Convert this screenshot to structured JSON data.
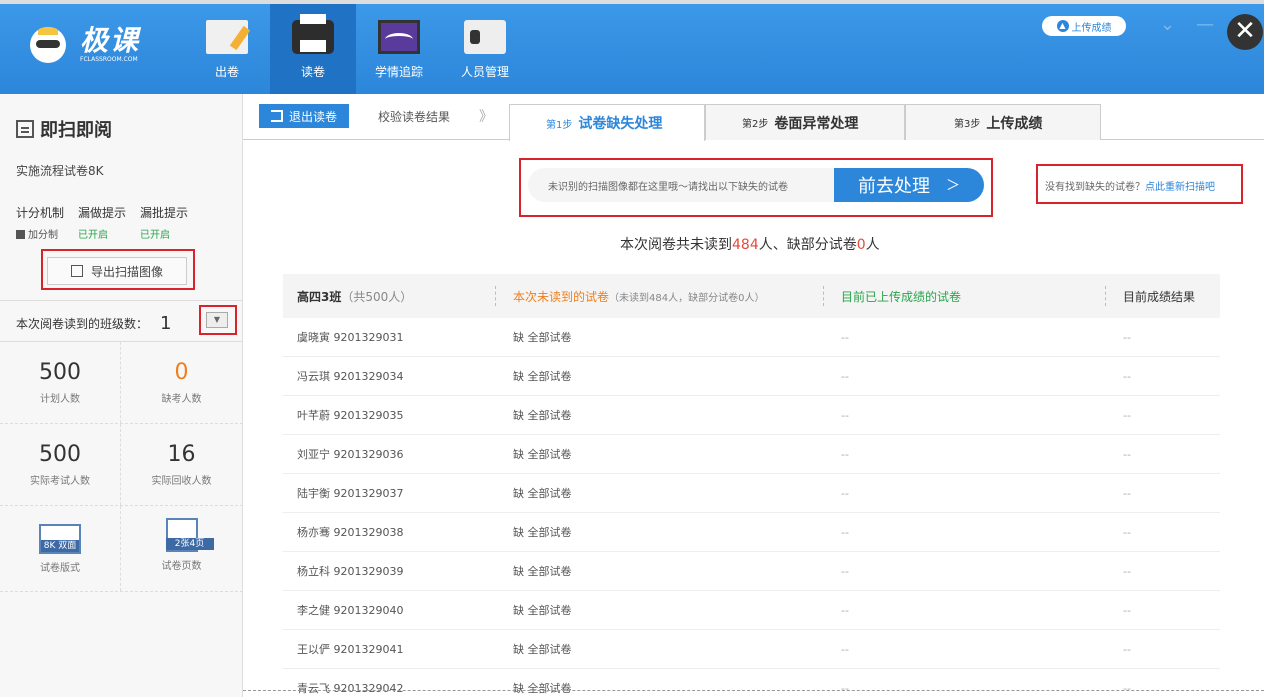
{
  "header": {
    "logo_title": "极课",
    "logo_sub": "FCLASSROOM.COM",
    "nav": [
      {
        "label": "出卷",
        "icon": "paper-pencil-icon"
      },
      {
        "label": "读卷",
        "icon": "printer-icon"
      },
      {
        "label": "学情追踪",
        "icon": "chart-monitor-icon"
      },
      {
        "label": "人员管理",
        "icon": "id-card-icon"
      }
    ],
    "upload_label": "上传成绩",
    "minimize": "—",
    "dropdown": "⌄",
    "close": "✕"
  },
  "sidebar": {
    "title": "即扫即阅",
    "exam_name": "实施流程试卷8K",
    "settings": [
      {
        "label": "计分机制",
        "value": "加分制",
        "value_color": "#555555"
      },
      {
        "label": "漏做提示",
        "value": "已开启",
        "value_color": "#2aa54a"
      },
      {
        "label": "漏批提示",
        "value": "已开启",
        "value_color": "#2aa54a"
      }
    ],
    "export_label": "导出扫描图像",
    "class_count_label": "本次阅卷读到的班级数：",
    "class_count": "1",
    "stats": [
      {
        "value": "500",
        "label": "计划人数",
        "color": "#333333"
      },
      {
        "value": "0",
        "label": "缺考人数",
        "color": "#f07f1b"
      },
      {
        "value": "500",
        "label": "实际考试人数",
        "color": "#333333"
      },
      {
        "value": "16",
        "label": "实际回收人数",
        "color": "#333333"
      }
    ],
    "format": {
      "icon_text": "8K 双面",
      "label": "试卷版式"
    },
    "pages": {
      "icon_text": "2张4页",
      "label": "试卷页数"
    }
  },
  "toolbar": {
    "exit_label": "退出读卷",
    "verify_label": "校验读卷结果",
    "chevron": "》",
    "tabs": [
      {
        "step": "第1步",
        "name": "试卷缺失处理",
        "active": true
      },
      {
        "step": "第2步",
        "name": "卷面异常处理",
        "active": false
      },
      {
        "step": "第3步",
        "name": "上传成绩",
        "active": false
      }
    ]
  },
  "notice": {
    "text": "未识别的扫描图像都在这里哦～请找出以下缺失的试卷",
    "button": "前去处理",
    "button_chevron": "＞",
    "rescan_prefix": "没有找到缺失的试卷？",
    "rescan_link": "点此重新扫描吧"
  },
  "summary": {
    "prefix": "本次阅卷共未读到",
    "missing": "484",
    "mid": "人、缺部分试卷",
    "partial": "0",
    "suffix": "人"
  },
  "table": {
    "class_name": "高四3班",
    "class_count": "（共500人）",
    "col_missing": "本次未读到的试卷",
    "col_missing_detail": "（未读到484人，缺部分试卷0人）",
    "col_uploaded": "目前已上传成绩的试卷",
    "col_result": "目前成绩结果",
    "rows": [
      {
        "name": "虞晓寅 9201329031",
        "missing": "缺 全部试卷",
        "uploaded": "--",
        "result": "--"
      },
      {
        "name": "冯云琪 9201329034",
        "missing": "缺 全部试卷",
        "uploaded": "--",
        "result": "--"
      },
      {
        "name": "叶芊蔚 9201329035",
        "missing": "缺 全部试卷",
        "uploaded": "--",
        "result": "--"
      },
      {
        "name": "刘亚宁 9201329036",
        "missing": "缺 全部试卷",
        "uploaded": "--",
        "result": "--"
      },
      {
        "name": "陆宇衡 9201329037",
        "missing": "缺 全部试卷",
        "uploaded": "--",
        "result": "--"
      },
      {
        "name": "杨亦骞 9201329038",
        "missing": "缺 全部试卷",
        "uploaded": "--",
        "result": "--"
      },
      {
        "name": "杨立科 9201329039",
        "missing": "缺 全部试卷",
        "uploaded": "--",
        "result": "--"
      },
      {
        "name": "李之健 9201329040",
        "missing": "缺 全部试卷",
        "uploaded": "--",
        "result": "--"
      },
      {
        "name": "王以俨 9201329041",
        "missing": "缺 全部试卷",
        "uploaded": "--",
        "result": "--"
      },
      {
        "name": "青云飞 9201329042",
        "missing": "缺 全部试卷",
        "uploaded": "--",
        "result": "--"
      }
    ]
  },
  "colors": {
    "brand": "#2c86da",
    "alert": "#d9232b",
    "warning": "#f07f1b",
    "success": "#2aa54a"
  }
}
